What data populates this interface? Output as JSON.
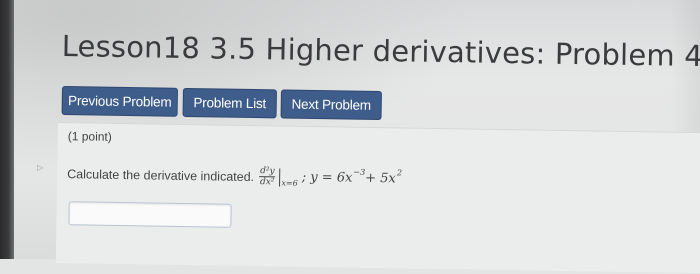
{
  "page": {
    "title": "Lesson18 3.5 Higher derivatives: Problem 4"
  },
  "nav": {
    "previous_label": "Previous Problem",
    "list_label": "Problem List",
    "next_label": "Next Problem",
    "button_color": "#3f5d8a"
  },
  "problem": {
    "points": "(1 point)",
    "prompt": "Calculate the derivative indicated.",
    "math": {
      "numerator": "d²y",
      "denominator": "dx²",
      "evaluated_at": "x=6",
      "separator": ";",
      "equation_lhs": "y = 6x",
      "exp1": "−3",
      "plus": " + 5x",
      "exp2": "2"
    },
    "answer": {
      "value": "",
      "placeholder": ""
    }
  },
  "decoration": {
    "edge_glyph": "▷"
  }
}
